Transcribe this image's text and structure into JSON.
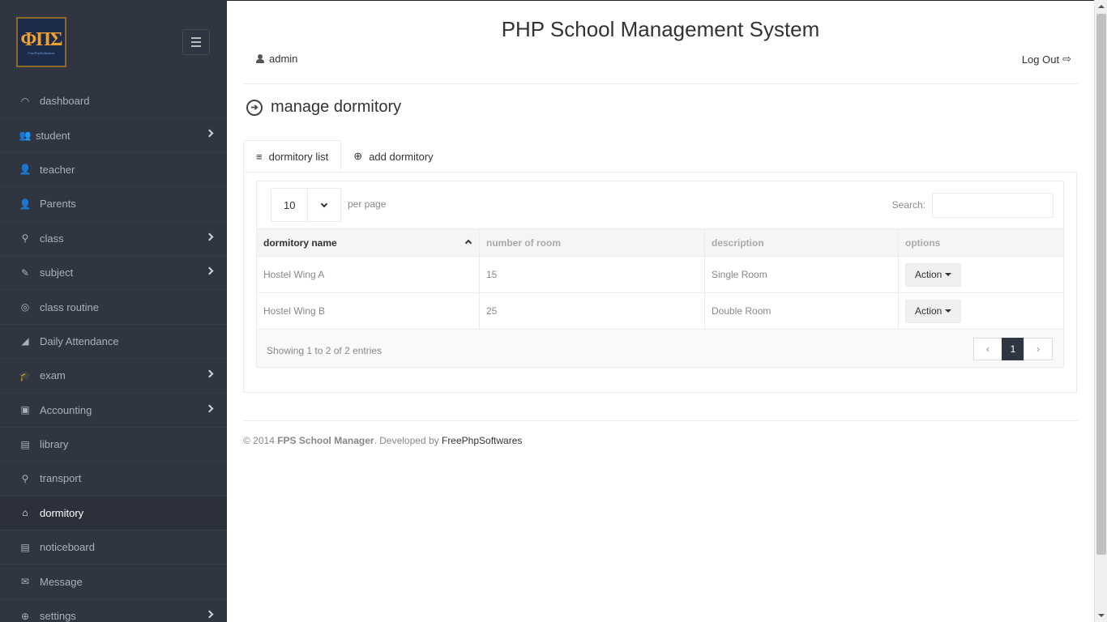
{
  "app": {
    "title": "PHP School Management System",
    "logo_text": "ΦΠΣ",
    "logo_subtext": "FreePhpSoftwares"
  },
  "sidebar": {
    "items": [
      {
        "label": "dashboard",
        "icon": "dashboard-icon",
        "glyph": "◠"
      },
      {
        "label": "student",
        "icon": "users-icon",
        "glyph": "👥"
      },
      {
        "label": "teacher",
        "icon": "teacher-icon",
        "glyph": "👤"
      },
      {
        "label": "Parents",
        "icon": "user-icon",
        "glyph": "👤"
      },
      {
        "label": "class",
        "icon": "sitemap-icon",
        "glyph": "⚲"
      },
      {
        "label": "subject",
        "icon": "book-icon",
        "glyph": "✎"
      },
      {
        "label": "class routine",
        "icon": "target-icon",
        "glyph": "◎"
      },
      {
        "label": "Daily Attendance",
        "icon": "chart-area-icon",
        "glyph": "◢"
      },
      {
        "label": "exam",
        "icon": "graduation-cap-icon",
        "glyph": "🎓"
      },
      {
        "label": "Accounting",
        "icon": "briefcase-icon",
        "glyph": "▣"
      },
      {
        "label": "library",
        "icon": "library-book-icon",
        "glyph": "▤"
      },
      {
        "label": "transport",
        "icon": "location-icon",
        "glyph": "⚲"
      },
      {
        "label": "dormitory",
        "icon": "home-icon",
        "glyph": "⌂"
      },
      {
        "label": "noticeboard",
        "icon": "document-icon",
        "glyph": "▤"
      },
      {
        "label": "Message",
        "icon": "mail-icon",
        "glyph": "✉"
      },
      {
        "label": "settings",
        "icon": "globe-icon",
        "glyph": "⊕"
      }
    ]
  },
  "header": {
    "username": "admin",
    "logout_label": "Log Out",
    "logout_glyph": "⇨"
  },
  "page": {
    "title": "manage dormitory",
    "title_glyph": "➔",
    "tabs": [
      {
        "label": "dormitory list",
        "glyph": "≡"
      },
      {
        "label": "add dormitory",
        "glyph": "⊕"
      }
    ]
  },
  "datatable": {
    "length_value": "10",
    "per_page_label": "per page",
    "search_label": "Search:",
    "search_value": "",
    "columns": [
      "dormitory name",
      "number of room",
      "description",
      "options"
    ],
    "rows": [
      {
        "name": "Hostel Wing A",
        "rooms": "15",
        "description": "Single Room",
        "action": "Action"
      },
      {
        "name": "Hostel Wing B",
        "rooms": "25",
        "description": "Double Room",
        "action": "Action"
      }
    ],
    "info": "Showing 1 to 2 of 2 entries",
    "pager": {
      "prev": "‹",
      "current": "1",
      "next": "›"
    }
  },
  "footer": {
    "copyright": "© 2014",
    "product": "FPS School Manager",
    "developed_by": ". Developed by",
    "developer": "FreePhpSoftwares"
  },
  "colors": {
    "sidebar_bg": "#303641",
    "active_item_bg": "#2b303a",
    "accent": "#303641"
  }
}
